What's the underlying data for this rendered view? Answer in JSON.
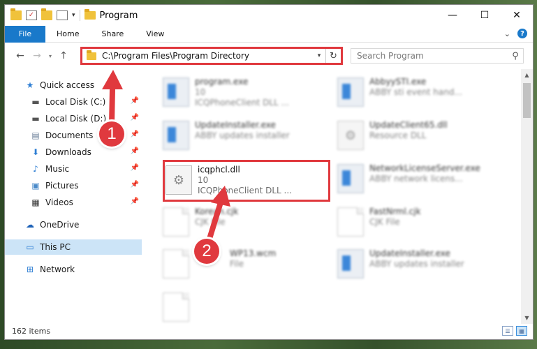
{
  "window": {
    "title": "Program",
    "controls": {
      "minimize": "—",
      "maximize": "☐",
      "close": "✕"
    }
  },
  "ribbon": {
    "tabs": [
      "File",
      "Home",
      "Share",
      "View"
    ]
  },
  "address": {
    "path": "C:\\Program Files\\Program Directory",
    "search_placeholder": "Search Program"
  },
  "navigation": {
    "items": [
      {
        "label": "Quick access",
        "icon": "star-icon",
        "pinned": false
      },
      {
        "label": "Local Disk (C:)",
        "icon": "drive-icon",
        "pinned": true
      },
      {
        "label": "Local Disk (D:)",
        "icon": "drive-icon",
        "pinned": true
      },
      {
        "label": "Documents",
        "icon": "documents-icon",
        "pinned": true
      },
      {
        "label": "Downloads",
        "icon": "downloads-icon",
        "pinned": true
      },
      {
        "label": "Music",
        "icon": "music-icon",
        "pinned": true
      },
      {
        "label": "Pictures",
        "icon": "pictures-icon",
        "pinned": true
      },
      {
        "label": "Videos",
        "icon": "videos-icon",
        "pinned": true
      },
      {
        "label": "OneDrive",
        "icon": "cloud-icon",
        "pinned": false
      },
      {
        "label": "This PC",
        "icon": "pc-icon",
        "pinned": false,
        "selected": true
      },
      {
        "label": "Network",
        "icon": "network-icon",
        "pinned": false
      }
    ]
  },
  "files": [
    {
      "name": "program.exe",
      "line2": "10",
      "line3": "ICQPhoneClient DLL ...",
      "icon": "app-icon",
      "blurred": true
    },
    {
      "name": "AbbyySTI.exe",
      "line2": "ABBY sti event hand...",
      "line3": "",
      "icon": "app-icon",
      "blurred": true
    },
    {
      "name": "UpdateInstaller.exe",
      "line2": "ABBY updates installer",
      "line3": "",
      "icon": "app-icon",
      "blurred": true
    },
    {
      "name": "UpdateClient65.dll",
      "line2": "Resource DLL",
      "line3": "",
      "icon": "gear-file-icon",
      "blurred": true
    },
    {
      "name": "icqphcl.dll",
      "line2": "10",
      "line3": "ICQPhoneClient DLL ...",
      "icon": "gear-file-icon",
      "blurred": false
    },
    {
      "name": "NetworkLicenseServer.exe",
      "line2": "ABBY network licens...",
      "line3": "",
      "icon": "app-icon",
      "blurred": true
    },
    {
      "name": "Korean.cjk",
      "line2": "CJK File",
      "line3": "",
      "icon": "document-icon",
      "blurred": true
    },
    {
      "name": "FastNrml.cjk",
      "line2": "CJK File",
      "line3": "",
      "icon": "document-icon",
      "blurred": true
    },
    {
      "name": "WP13.wcm",
      "line2": "File",
      "line3": "",
      "icon": "document-icon",
      "blurred": true
    },
    {
      "name": "UpdateInstaller.exe",
      "line2": "ABBY updates installer",
      "line3": "",
      "icon": "app-icon",
      "blurred": true
    },
    {
      "name": "",
      "line2": "",
      "line3": "",
      "icon": "document-icon",
      "blurred": true
    }
  ],
  "status": {
    "item_count": "162 items"
  },
  "steps": [
    "1",
    "2"
  ],
  "colors": {
    "accent": "#1979ca",
    "highlight": "#e0393e",
    "selection": "#cce4f7"
  }
}
